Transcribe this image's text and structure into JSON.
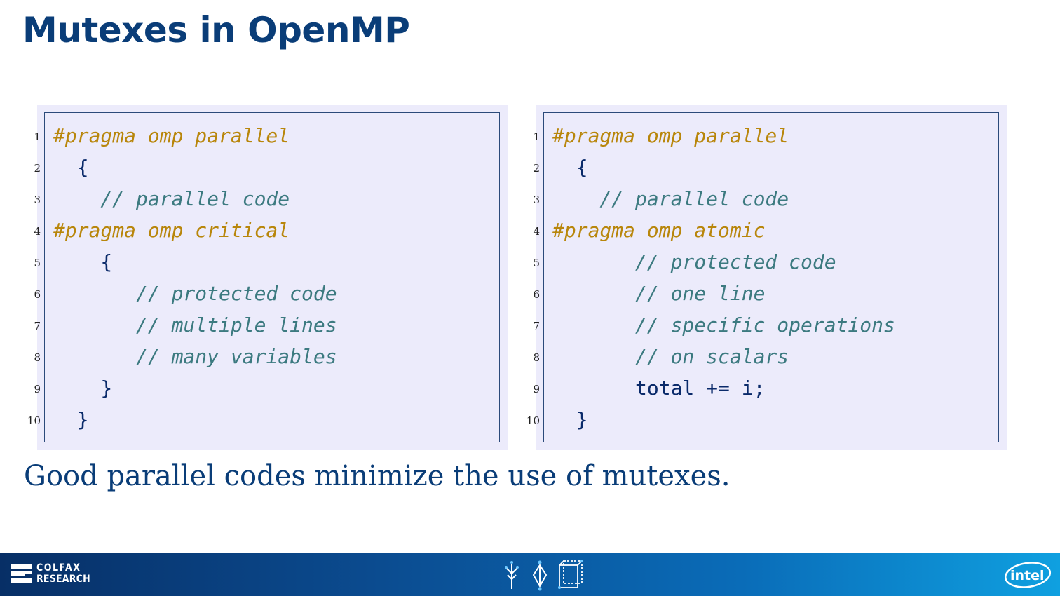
{
  "slide": {
    "title": "Mutexes in OpenMP",
    "caption": "Good parallel codes minimize the use of mutexes."
  },
  "left_code": {
    "lines": [
      {
        "num": "1",
        "text": "#pragma omp parallel"
      },
      {
        "num": "2",
        "text": "  {"
      },
      {
        "num": "3",
        "text": "    // parallel code"
      },
      {
        "num": "4",
        "text": "#pragma omp critical"
      },
      {
        "num": "5",
        "text": "    {"
      },
      {
        "num": "6",
        "text": "       // protected code"
      },
      {
        "num": "7",
        "text": "       // multiple lines"
      },
      {
        "num": "8",
        "text": "       // many variables"
      },
      {
        "num": "9",
        "text": "    }"
      },
      {
        "num": "10",
        "text": "  }"
      }
    ]
  },
  "right_code": {
    "lines": [
      {
        "num": "1",
        "text": "#pragma omp parallel"
      },
      {
        "num": "2",
        "text": "  {"
      },
      {
        "num": "3",
        "text": "    // parallel code"
      },
      {
        "num": "4",
        "text": "#pragma omp atomic"
      },
      {
        "num": "5",
        "text": "       // protected code"
      },
      {
        "num": "6",
        "text": "       // one line"
      },
      {
        "num": "7",
        "text": "       // specific operations"
      },
      {
        "num": "8",
        "text": "       // on scalars"
      },
      {
        "num": "9",
        "text": "       total += i;"
      },
      {
        "num": "10",
        "text": "  }"
      }
    ]
  },
  "footer": {
    "logo_line1": "COLFAX",
    "logo_line2": "RESEARCH",
    "intel_logo": "intel"
  },
  "colors": {
    "title": "#0a3d78",
    "pragma": "#b8860b",
    "comment": "#3c7a80",
    "panel_bg": "#ecebfb"
  },
  "icons": [
    "colfax-logo-icon",
    "tree-icon",
    "diamond-icon",
    "cube-icon",
    "intel-logo-icon"
  ]
}
